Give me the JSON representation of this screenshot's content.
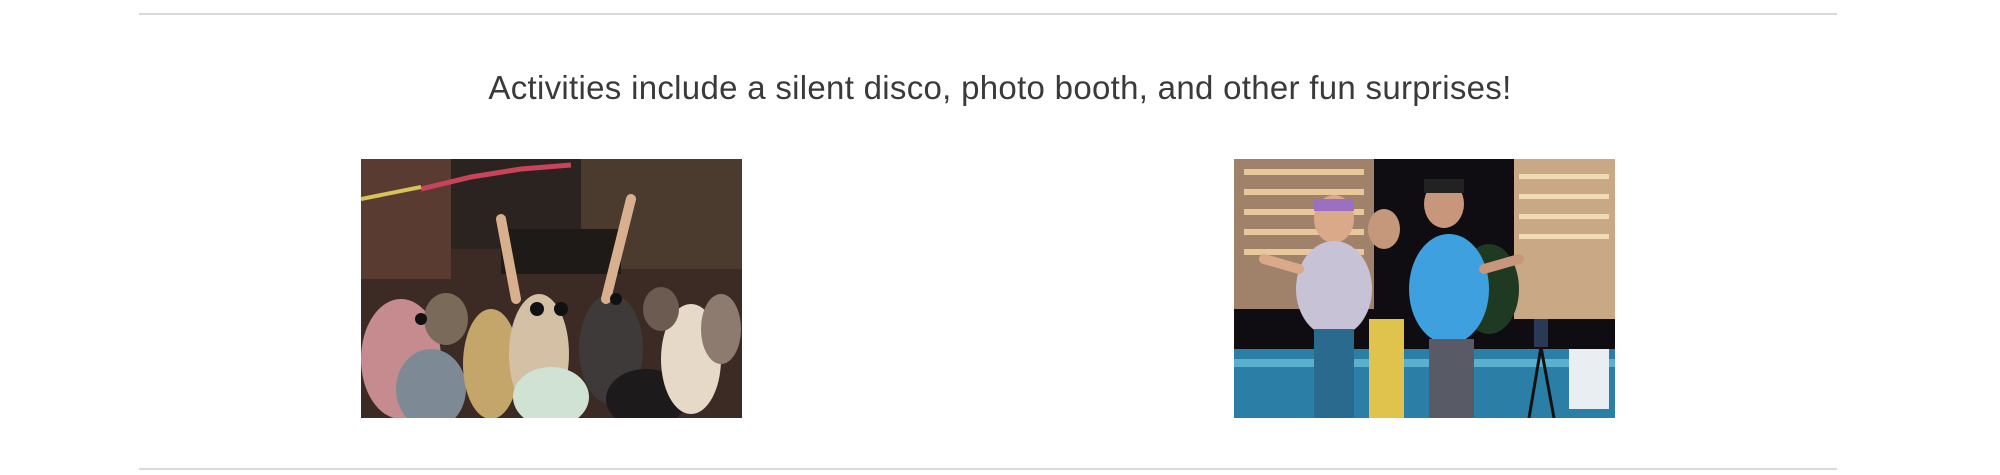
{
  "section": {
    "headline": "Activities include a silent disco, photo booth, and other fun surprises!"
  },
  "images": [
    {
      "name": "silent-disco-photo"
    },
    {
      "name": "photo-booth-photo"
    }
  ]
}
